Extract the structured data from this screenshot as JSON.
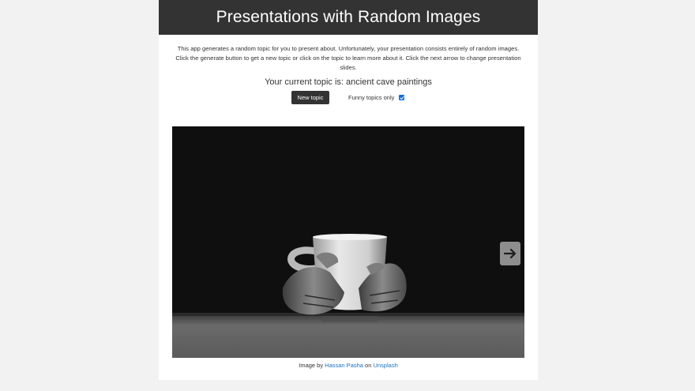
{
  "header": {
    "title": "Presentations with Random Images"
  },
  "intro": {
    "text": "This app generates a random topic for you to present about. Unfortunately, your presentation consists entirely of random images. Click the generate button to get a new topic or click on the topic to learn more about it. Click the next arrow to change presentation slides."
  },
  "topic": {
    "prefix": "Your current topic is: ",
    "value": "ancient cave paintings"
  },
  "controls": {
    "new_topic_label": "New topic",
    "funny_label": "Funny topics only",
    "funny_checked": true
  },
  "slide": {
    "image_alt": "black and white photo of hands holding a white mug",
    "next_icon": "arrow-right-icon"
  },
  "credit": {
    "prefix": "Image by ",
    "author": "Hassan Pasha",
    "middle": " on ",
    "site": "Unsplash"
  },
  "colors": {
    "banner": "#333333",
    "button": "#333333",
    "link": "#1a6fc2",
    "checkbox": "#0a6dd8",
    "arrow_bg": "#8e8e8e"
  }
}
